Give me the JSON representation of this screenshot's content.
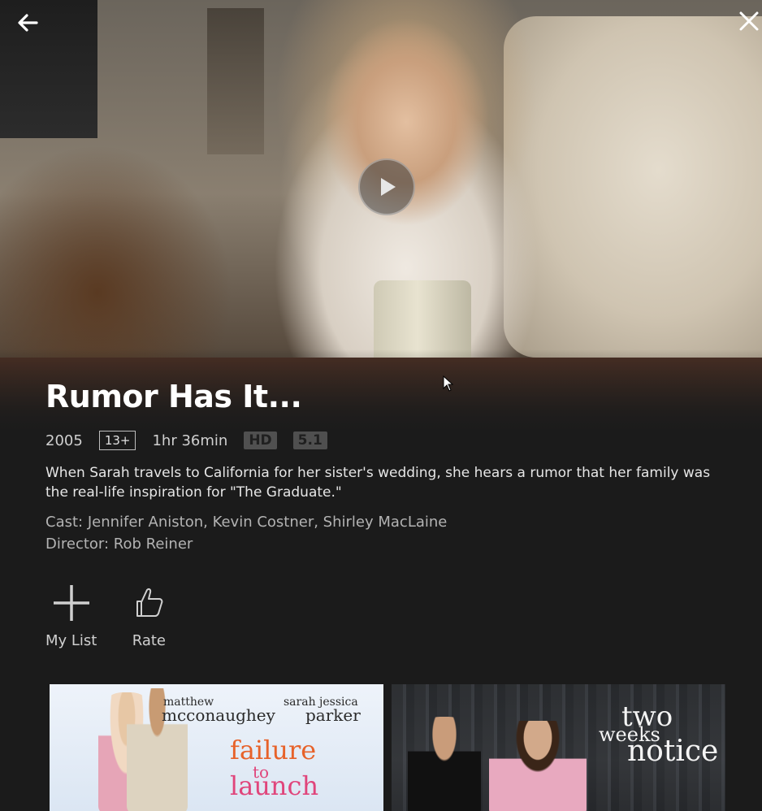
{
  "movie": {
    "title": "Rumor Has It...",
    "year": "2005",
    "maturity_rating": "13+",
    "duration": "1hr 36min",
    "quality_badge": "HD",
    "audio_badge": "5.1",
    "description": "When Sarah travels to California for her sister's wedding, she hears a rumor that her family was the real-life inspiration for \"The Graduate.\"",
    "cast": "Cast: Jennifer Aniston, Kevin Costner, Shirley MacLaine",
    "director": "Director: Rob Reiner"
  },
  "actions": {
    "my_list_label": "My List",
    "rate_label": "Rate"
  },
  "icons": {
    "back": "arrow-left-icon",
    "close": "close-icon",
    "play": "play-icon",
    "add": "plus-icon",
    "rate": "thumbs-up-icon"
  },
  "related": [
    {
      "credit1_first": "matthew",
      "credit1_last": "mcconaughey",
      "credit2_first": "sarah jessica",
      "credit2_last": "parker",
      "title_line1": "failure",
      "title_line2": "to",
      "title_line3": "launch"
    },
    {
      "title_line1": "two",
      "title_line2": "weeks",
      "title_line3": "notice"
    }
  ],
  "colors": {
    "background": "#1b1b1b",
    "text_primary": "#ffffff",
    "text_secondary": "#b3b3b3"
  }
}
